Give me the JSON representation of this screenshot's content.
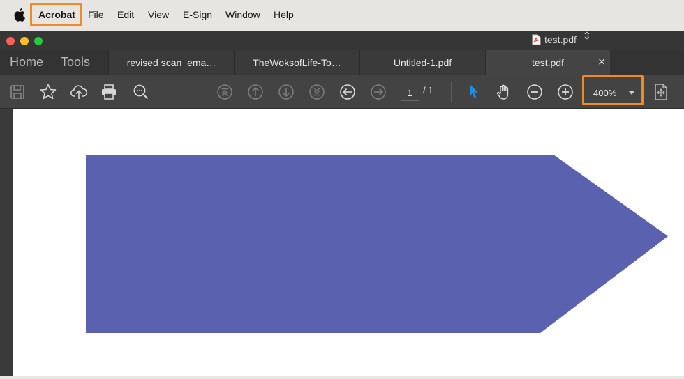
{
  "menubar": {
    "app": "Acrobat",
    "items": [
      "File",
      "Edit",
      "View",
      "E-Sign",
      "Window",
      "Help"
    ]
  },
  "window": {
    "title": "test.pdf"
  },
  "tabbar": {
    "nav": [
      "Home",
      "Tools"
    ],
    "docs": [
      "revised scan_ema…",
      "TheWoksofLife-To…",
      "Untitled-1.pdf",
      "test.pdf"
    ],
    "close": "×"
  },
  "toolbar": {
    "page_current": "1",
    "page_total": "/ 1",
    "zoom": "400%",
    "icons": [
      "save-icon",
      "bookmark-star-icon",
      "upload-cloud-icon",
      "print-icon",
      "search-zoom-icon",
      "first-page-icon",
      "prev-page-icon",
      "next-page-icon",
      "last-page-icon",
      "back-icon",
      "forward-icon",
      "select-cursor-icon",
      "hand-tool-icon",
      "zoom-out-icon",
      "zoom-in-icon",
      "page-fit-icon"
    ]
  },
  "document": {
    "shape_color": "#5a62b0"
  },
  "colors": {
    "highlight": "#f08a24",
    "cursor_blue": "#1e8fe8"
  }
}
